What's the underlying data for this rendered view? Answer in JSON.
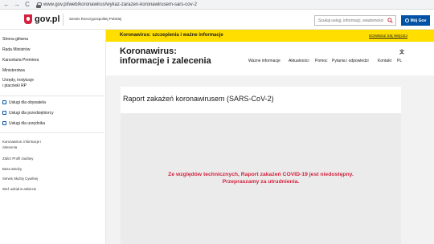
{
  "browser": {
    "back": "←",
    "forward": "→",
    "reload": "C",
    "url": "www.gov.pl/web/koronawirus/wykaz-zarazen-koronawirusem-sars-cov-2"
  },
  "header": {
    "logo": "gov.pl",
    "subtitle": "Serwis Rzeczypospolitej Polskiej",
    "search_placeholder": "Szukaj usług, informacji, wiadomości",
    "account_button": "Mój Gov"
  },
  "sidebar": {
    "main_links": [
      "Strona główna",
      "Rada Ministrów",
      "Kancelaria Premiera",
      "Ministerstwa"
    ],
    "institutions": [
      "Urzędy, instytucje",
      "i placówki RP"
    ],
    "services": [
      "Usługi dla obywatela",
      "Usługi dla przedsiębiorcy",
      "Usługi dla urzędnika"
    ],
    "extra": [
      "Koronawirus: informacje i",
      "zalecenia",
      "Zalicz Profil zaufany",
      "Baza wiedzy",
      "Serwis Służby Cywilnej",
      "Weź udział w ankiecie"
    ]
  },
  "alert": {
    "text": "Koronawirus: szczepienia i ważne informacje",
    "link": "DOWIEDZ SIĘ WIĘCEJ"
  },
  "page": {
    "title": "Koronawirus:\ninformacje i zalecenia",
    "nav": [
      "Ważne informacje",
      "Aktualności",
      "Pomoc",
      "Pytania i odpowiedzi",
      "Kontakt",
      "PL"
    ],
    "lang_icon": "文",
    "report_title": "Raport zakażeń koronawirusem (SARS-CoV-2)",
    "report_message_line1": "Ze względów technicznych, Raport zakażeń COVID-19 jest niedostępny.",
    "report_message_line2": "Przepraszamy za utrudnienia."
  },
  "colors": {
    "alert_bg": "#ffde00",
    "brand_blue": "#0052a5",
    "brand_red": "#d4213d"
  }
}
